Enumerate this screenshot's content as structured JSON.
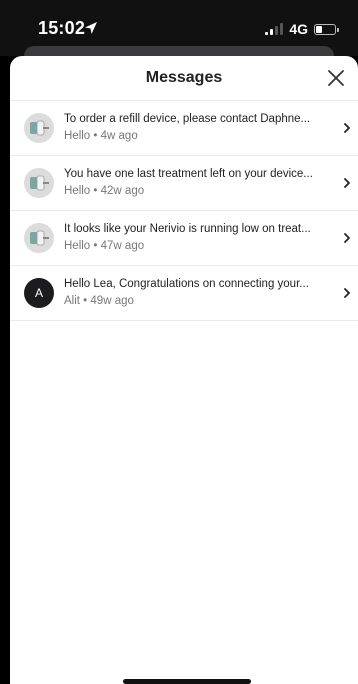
{
  "status_bar": {
    "time": "15:02",
    "network": "4G"
  },
  "sheet": {
    "title": "Messages"
  },
  "messages": [
    {
      "text": "To order a refill device, please contact Daphne...",
      "sender": "Hello",
      "age": "4w ago",
      "avatar": "device"
    },
    {
      "text": "You have one last treatment left on your device...",
      "sender": "Hello",
      "age": "42w ago",
      "avatar": "device"
    },
    {
      "text": "It looks like your Nerivio is running low on treat...",
      "sender": "Hello",
      "age": "47w ago",
      "avatar": "device"
    },
    {
      "text": "Hello Lea, Congratulations on connecting your...",
      "sender": "Alit",
      "age": "49w ago",
      "avatar": "A"
    }
  ],
  "icons": {
    "location": "location-arrow-icon",
    "close": "close-icon",
    "chevron": "chevron-right-icon",
    "battery": "battery-icon",
    "signal": "signal-icon"
  }
}
